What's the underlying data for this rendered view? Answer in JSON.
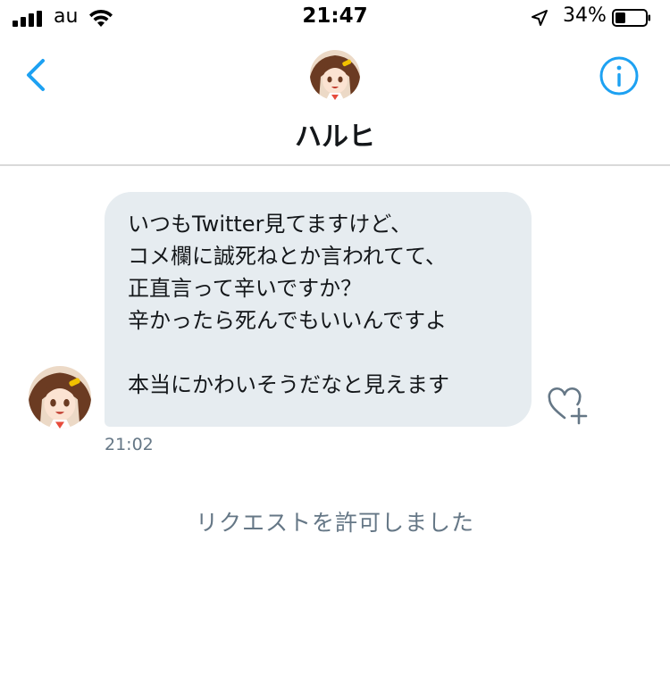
{
  "status_bar": {
    "carrier": "au",
    "time": "21:47",
    "battery_percent": "34%",
    "battery_level": 0.34,
    "icons": [
      "signal-icon",
      "wifi-icon",
      "location-arrow-icon",
      "battery-icon"
    ]
  },
  "header": {
    "title": "ハルヒ",
    "icons": [
      "chevron-left-icon",
      "avatar",
      "info-icon"
    ],
    "accent_color": "#1da1f2"
  },
  "conversation": {
    "message": {
      "lines": [
        "いつもTwitter見てますけど、",
        "コメ欄に誠死ねとか言われてて、",
        "正直言って辛いですか？",
        "辛かったら死んでもいいんですよ",
        "",
        "本当にかわいそうだなと見えます"
      ],
      "time": "21:02",
      "bubble_color": "#e6ecf0"
    },
    "system_notice": "リクエストを許可しました"
  }
}
